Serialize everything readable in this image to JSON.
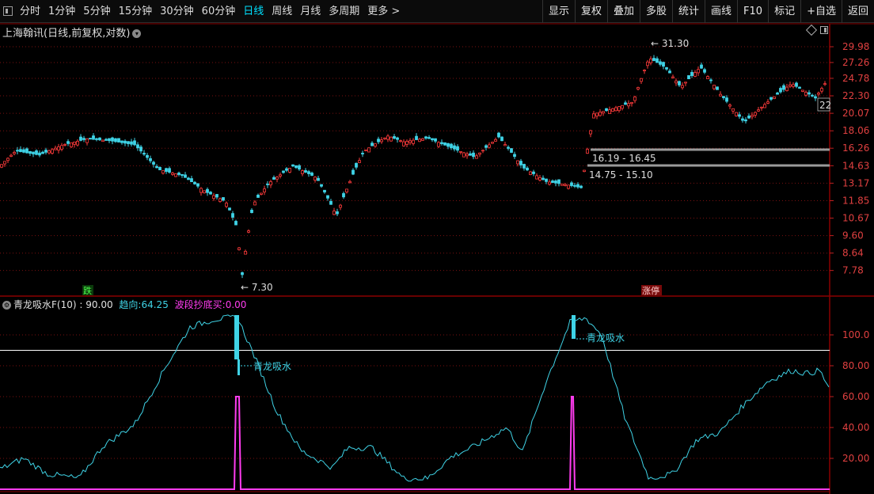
{
  "toolbar": {
    "periods": [
      "分时",
      "1分钟",
      "5分钟",
      "15分钟",
      "30分钟",
      "60分钟",
      "日线",
      "周线",
      "月线",
      "多周期",
      "更多 >"
    ],
    "active_period": "日线",
    "right_tools": [
      "显示",
      "复权",
      "叠加",
      "多股",
      "统计",
      "画线",
      "F10",
      "标记",
      "+自选",
      "返回"
    ]
  },
  "main_chart": {
    "title": "上海翰讯(日线,前复权,对数)",
    "price_axis": [
      "29.98",
      "27.26",
      "24.78",
      "22.30",
      "20.07",
      "18.06",
      "16.26",
      "14.63",
      "13.17",
      "11.85",
      "10.67",
      "9.60",
      "8.64",
      "7.78"
    ],
    "high_label": "31.30",
    "low_label": "7.30",
    "zone_upper_label": "16.19 - 16.45",
    "zone_lower_label": "14.75 - 15.10",
    "last_price_tag": "22",
    "marker_down": "跌",
    "marker_up": "涨停"
  },
  "indicator": {
    "name": "青龙吸水F(10)",
    "name_value": ": 90.00",
    "trend_label": "趋向:",
    "trend_value": "64.25",
    "bottom_label": "波段抄底买:",
    "bottom_value": "0.00",
    "axis": [
      "100.0",
      "80.00",
      "60.00",
      "40.00",
      "20.00"
    ],
    "signal_text": "青龙吸水",
    "colors": {
      "trend": "#3fd3e6",
      "bottom": "#ff3cf0",
      "name": "#e0e0e0",
      "ref_line": "#ffffff"
    }
  },
  "chart_data": {
    "type": "line",
    "series": [
      {
        "x": [
          0,
          20,
          50,
          80,
          110,
          140,
          170,
          200,
          230,
          260,
          285,
          300,
          305,
          320,
          340,
          370,
          400,
          425,
          440,
          460,
          490,
          510,
          540,
          570,
          600,
          630,
          660,
          690,
          720,
          735,
          750,
          770,
          800,
          820,
          840,
          860,
          885,
          910,
          940,
          970,
          1000,
          1030,
          1048
        ],
        "values": [
          14.6,
          16.0,
          15.6,
          16.6,
          17.2,
          17.0,
          16.6,
          14.3,
          13.8,
          12.5,
          11.8,
          10.0,
          7.3,
          11.6,
          13.2,
          14.6,
          13.6,
          10.8,
          13.0,
          16.0,
          17.5,
          16.9,
          17.3,
          16.3,
          15.4,
          17.4,
          14.5,
          13.3,
          13.0,
          12.8,
          20.0,
          20.5,
          21.5,
          28.0,
          26.5,
          23.5,
          26.5,
          22.5,
          19.0,
          21.5,
          24.0,
          22.0,
          25.0
        ]
      },
      {
        "x": [
          0,
          30,
          60,
          100,
          130,
          170,
          210,
          240,
          270,
          290,
          300,
          320,
          350,
          380,
          420,
          440,
          470,
          510,
          540,
          570,
          600,
          640,
          660,
          690,
          720,
          740,
          760,
          790,
          820,
          850,
          880,
          910,
          940,
          970,
          1000,
          1020,
          1035,
          1048
        ],
        "values": [
          13,
          20,
          10,
          7,
          28,
          42,
          80,
          105,
          110,
          111,
          111,
          88,
          50,
          25,
          14,
          27,
          27,
          7,
          7,
          21,
          28,
          40,
          24,
          70,
          108,
          111,
          100,
          45,
          7,
          10,
          32,
          37,
          55,
          70,
          77,
          75,
          77,
          65
        ]
      },
      {
        "x": [
          0,
          296,
          298,
          302,
          304,
          720,
          722,
          724,
          726,
          1048
        ],
        "values": [
          0,
          0,
          60,
          60,
          0,
          0,
          60,
          60,
          0,
          0
        ]
      }
    ],
    "ylim_price": [
      7.3,
      31.3
    ],
    "ylim_indicator": [
      0,
      120
    ],
    "reference_line": 90,
    "grid": true
  }
}
